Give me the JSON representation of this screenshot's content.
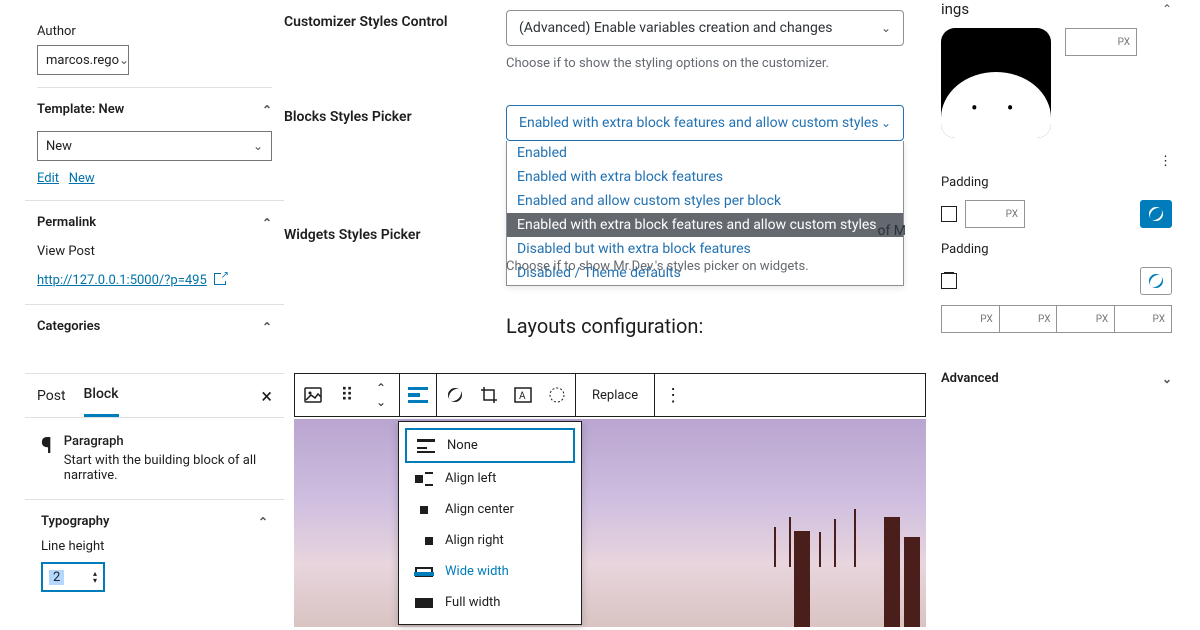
{
  "left": {
    "author_label": "Author",
    "author_value": "marcos.rego",
    "template_head": "Template: New",
    "template_value": "New",
    "edit": "Edit",
    "new": "New",
    "permalink_head": "Permalink",
    "view_post": "View Post",
    "permalink_url": "http://127.0.0.1:5000/?p=495",
    "categories_head": "Categories"
  },
  "center": {
    "customizer_label": "Customizer Styles Control",
    "customizer_value": "(Advanced) Enable variables creation and changes",
    "customizer_help": "Choose if to show the styling options on the customizer.",
    "blocks_label": "Blocks Styles Picker",
    "blocks_value": "Enabled with extra block features and allow custom styles",
    "blocks_options": [
      "Enabled",
      "Enabled with extra block features",
      "Enabled and allow custom styles per block",
      "Enabled with extra block features and allow custom styles",
      "Disabled but with extra block features",
      "Disabled / Theme defaults"
    ],
    "widgets_label": "Widgets Styles Picker",
    "widgets_trail_left": "of M",
    "widgets_help": "Choose if to show Mr.Dev.'s styles picker on widgets.",
    "layouts_title": "Layouts configuration:"
  },
  "right": {
    "settings_head": "ings",
    "padding1": "Padding",
    "padding2": "Padding",
    "advanced_head": "Advanced",
    "px": "PX"
  },
  "tabs": {
    "post": "Post",
    "block": "Block",
    "para_title": "Paragraph",
    "para_desc": "Start with the building block of all narrative.",
    "typo_head": "Typography",
    "lh_label": "Line height",
    "lh_value": "2"
  },
  "toolbar": {
    "replace": "Replace"
  },
  "align": {
    "none": "None",
    "left": "Align left",
    "center": "Align center",
    "right": "Align right",
    "wide": "Wide width",
    "full": "Full width"
  }
}
